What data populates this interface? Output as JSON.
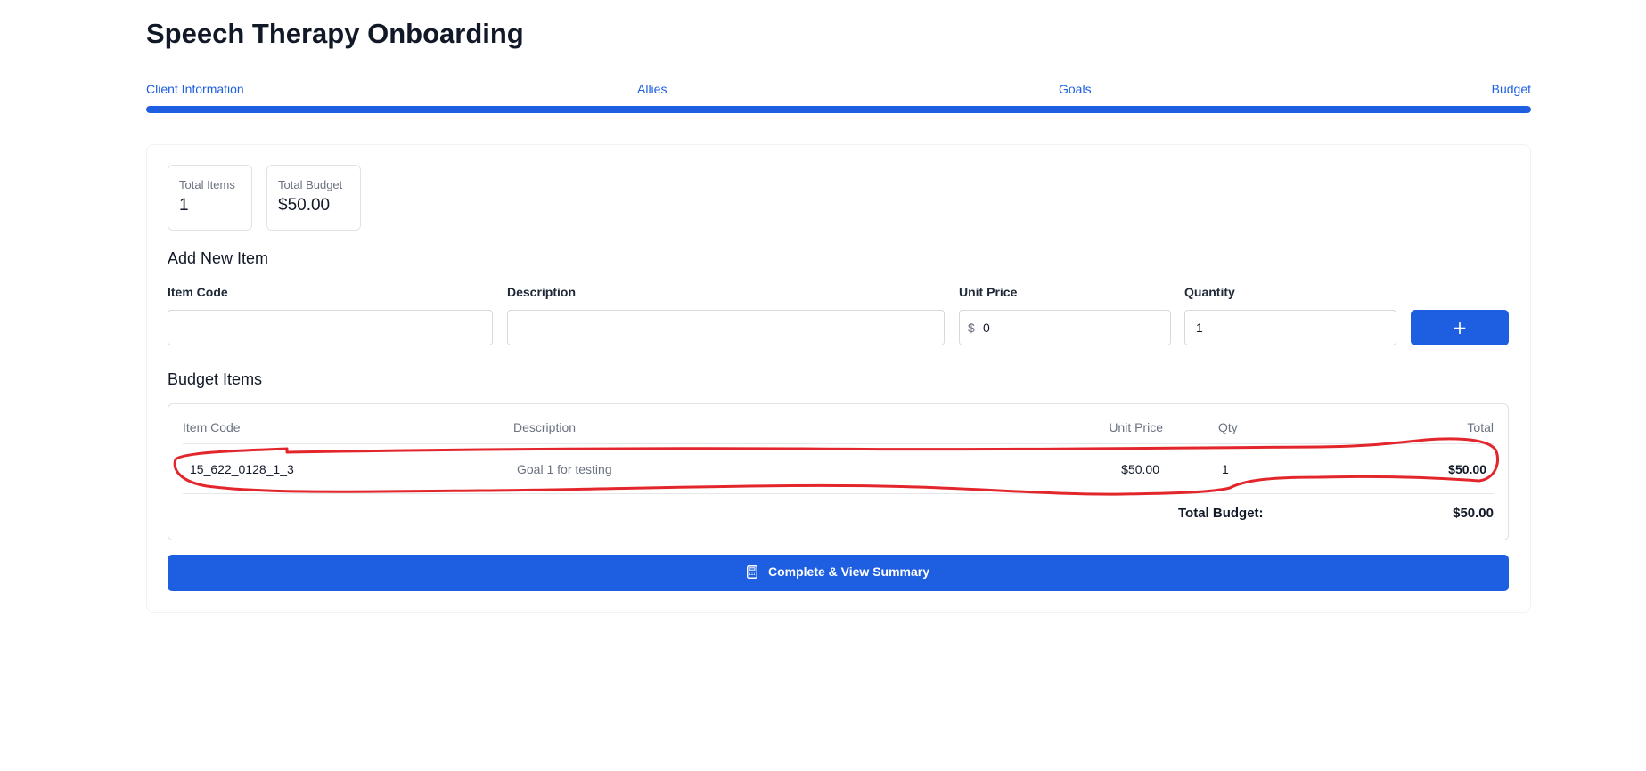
{
  "page": {
    "title": "Speech Therapy Onboarding"
  },
  "steps": {
    "items": [
      {
        "label": "Client Information"
      },
      {
        "label": "Allies"
      },
      {
        "label": "Goals"
      },
      {
        "label": "Budget"
      }
    ],
    "progress_percent": 100,
    "color": "#1d5fe0"
  },
  "stats": {
    "total_items_label": "Total Items",
    "total_items_value": "1",
    "total_budget_label": "Total Budget",
    "total_budget_value": "$50.00"
  },
  "add_item": {
    "title": "Add New Item",
    "item_code_label": "Item Code",
    "item_code_value": "",
    "description_label": "Description",
    "description_value": "",
    "unit_price_label": "Unit Price",
    "unit_price_prefix": "$",
    "unit_price_value": "0",
    "quantity_label": "Quantity",
    "quantity_value": "1",
    "add_button_label": "+",
    "add_button_icon": "plus-icon"
  },
  "budget_items": {
    "title": "Budget Items",
    "columns": {
      "item_code": "Item Code",
      "description": "Description",
      "unit_price": "Unit Price",
      "qty": "Qty",
      "total": "Total"
    },
    "rows": [
      {
        "item_code": "15_622_0128_1_3",
        "description": "Goal 1 for testing",
        "unit_price": "$50.00",
        "qty": "1",
        "total": "$50.00"
      }
    ],
    "total_label": "Total Budget:",
    "total_value": "$50.00",
    "annotation_color": "#e3262b"
  },
  "actions": {
    "complete_label": "Complete & View Summary",
    "complete_icon": "calculator-icon",
    "accent_color": "#1d5fe0"
  }
}
